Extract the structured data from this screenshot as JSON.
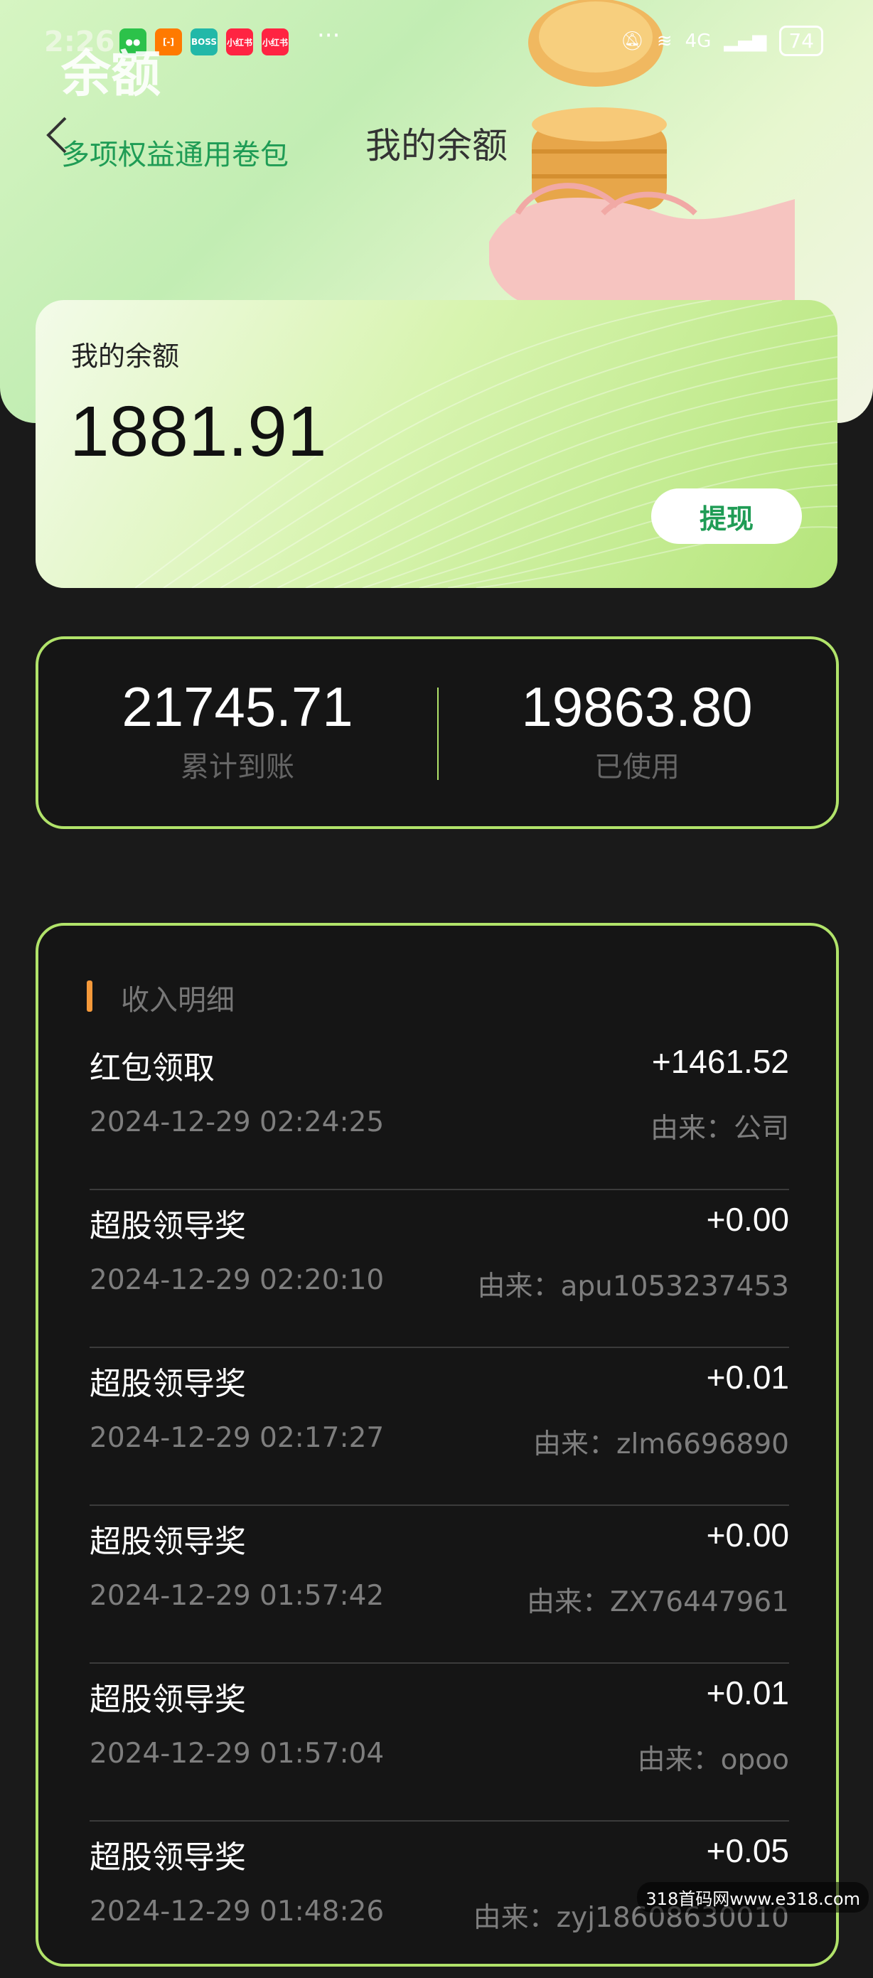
{
  "status_bar": {
    "time": "2:26",
    "network": "4G",
    "battery": "74"
  },
  "header": {
    "bg_word": "余额",
    "sub_title": "多项权益通用卷包",
    "title": "我的余额"
  },
  "balance": {
    "label": "我的余额",
    "value": "1881.91",
    "withdraw_label": "提现"
  },
  "stats": {
    "total": {
      "value": "21745.71",
      "label": "累计到账"
    },
    "used": {
      "value": "19863.80",
      "label": "已使用"
    }
  },
  "income": {
    "heading": "收入明细",
    "rows": [
      {
        "title": "红包领取",
        "amount": "+1461.52",
        "time": "2024-12-29 02:24:25",
        "source": "由来：公司"
      },
      {
        "title": "超股领导奖",
        "amount": "+0.00",
        "time": "2024-12-29 02:20:10",
        "source": "由来：apu1053237453"
      },
      {
        "title": "超股领导奖",
        "amount": "+0.01",
        "time": "2024-12-29 02:17:27",
        "source": "由来：zlm6696890"
      },
      {
        "title": "超股领导奖",
        "amount": "+0.00",
        "time": "2024-12-29 01:57:42",
        "source": "由来：ZX76447961"
      },
      {
        "title": "超股领导奖",
        "amount": "+0.01",
        "time": "2024-12-29 01:57:04",
        "source": "由来：opoo"
      },
      {
        "title": "超股领导奖",
        "amount": "+0.05",
        "time": "2024-12-29 01:48:26",
        "source": "由来：zyj18608630010"
      }
    ]
  },
  "watermark": "318首码网www.e318.com",
  "colors": {
    "accent_green": "#1f9c55",
    "card_border": "#b1e36a",
    "heading_bar": "#f5993a",
    "background": "#1a1a1a"
  }
}
